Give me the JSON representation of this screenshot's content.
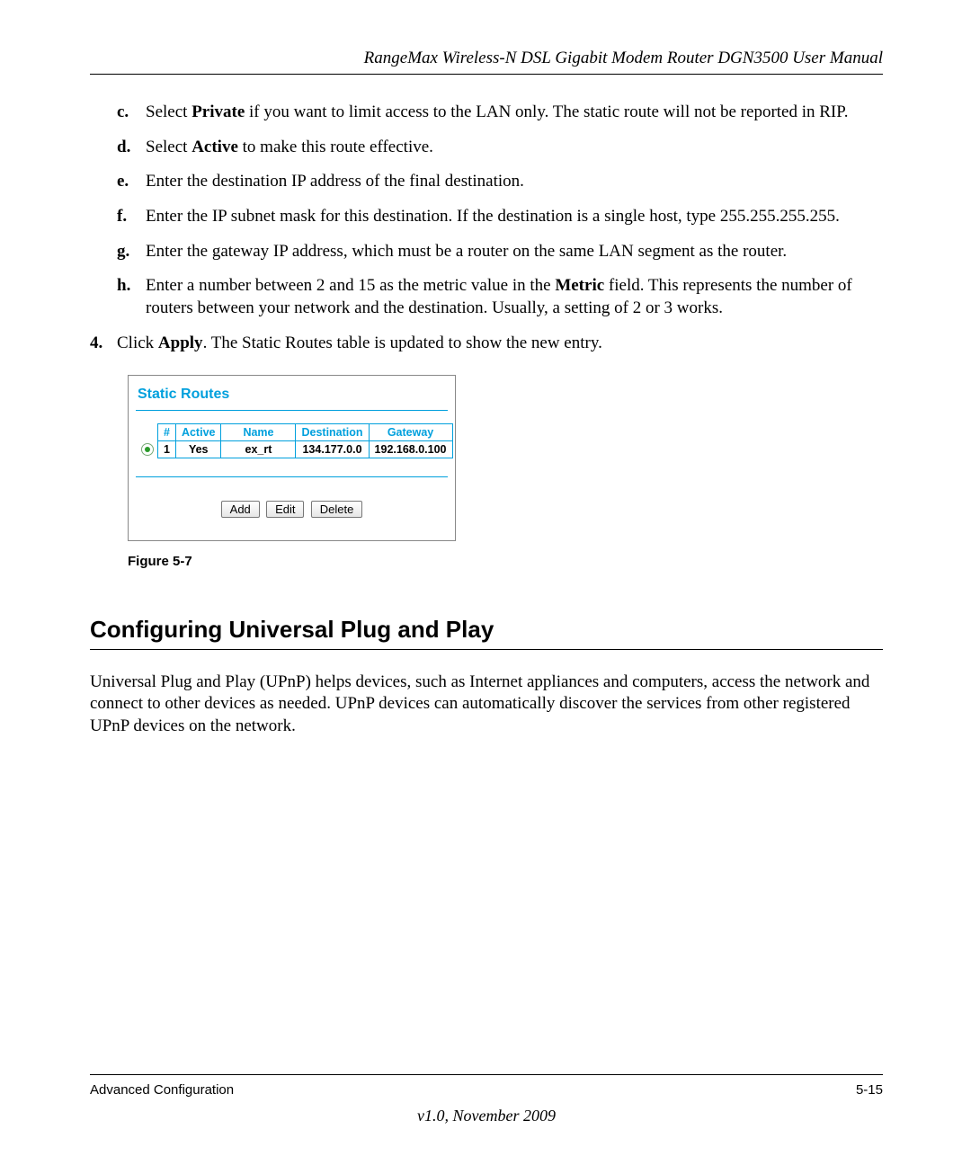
{
  "header": {
    "title": "RangeMax Wireless-N DSL Gigabit Modem Router DGN3500 User Manual"
  },
  "steps": {
    "c": {
      "marker": "c.",
      "prefix": "Select ",
      "bold": "Private",
      "suffix": " if you want to limit access to the LAN only. The static route will not be reported in RIP."
    },
    "d": {
      "marker": "d.",
      "prefix": "Select ",
      "bold": "Active",
      "suffix": " to make this route effective."
    },
    "e": {
      "marker": "e.",
      "text": "Enter the destination IP address of the final destination."
    },
    "f": {
      "marker": "f.",
      "text": "Enter the IP subnet mask for this destination. If the destination is a single host, type 255.255.255.255."
    },
    "g": {
      "marker": "g.",
      "text": "Enter the gateway IP address, which must be a router on the same LAN segment as the router."
    },
    "h": {
      "marker": "h.",
      "prefix": "Enter a number between 2 and 15 as the metric value in the ",
      "bold": "Metric",
      "suffix": " field. This represents the number of routers between your network and the destination. Usually, a setting of 2 or 3 works."
    },
    "four": {
      "marker": "4.",
      "prefix": "Click ",
      "bold": "Apply",
      "suffix": ". The Static Routes table is updated to show the new entry."
    }
  },
  "figure": {
    "title": "Static Routes",
    "headers": {
      "num": "#",
      "active": "Active",
      "name": "Name",
      "destination": "Destination",
      "gateway": "Gateway"
    },
    "row": {
      "num": "1",
      "active": "Yes",
      "name": "ex_rt",
      "destination": "134.177.0.0",
      "gateway": "192.168.0.100"
    },
    "buttons": {
      "add": "Add",
      "edit": "Edit",
      "delete": "Delete"
    },
    "caption": "Figure 5-7"
  },
  "section": {
    "heading": "Configuring Universal Plug and Play",
    "para": "Universal Plug and Play (UPnP) helps devices, such as Internet appliances and computers, access the network and connect to other devices as needed. UPnP devices can automatically discover the services from other registered UPnP devices on the network."
  },
  "footer": {
    "left": "Advanced Configuration",
    "right": "5-15",
    "version": "v1.0, November 2009"
  }
}
